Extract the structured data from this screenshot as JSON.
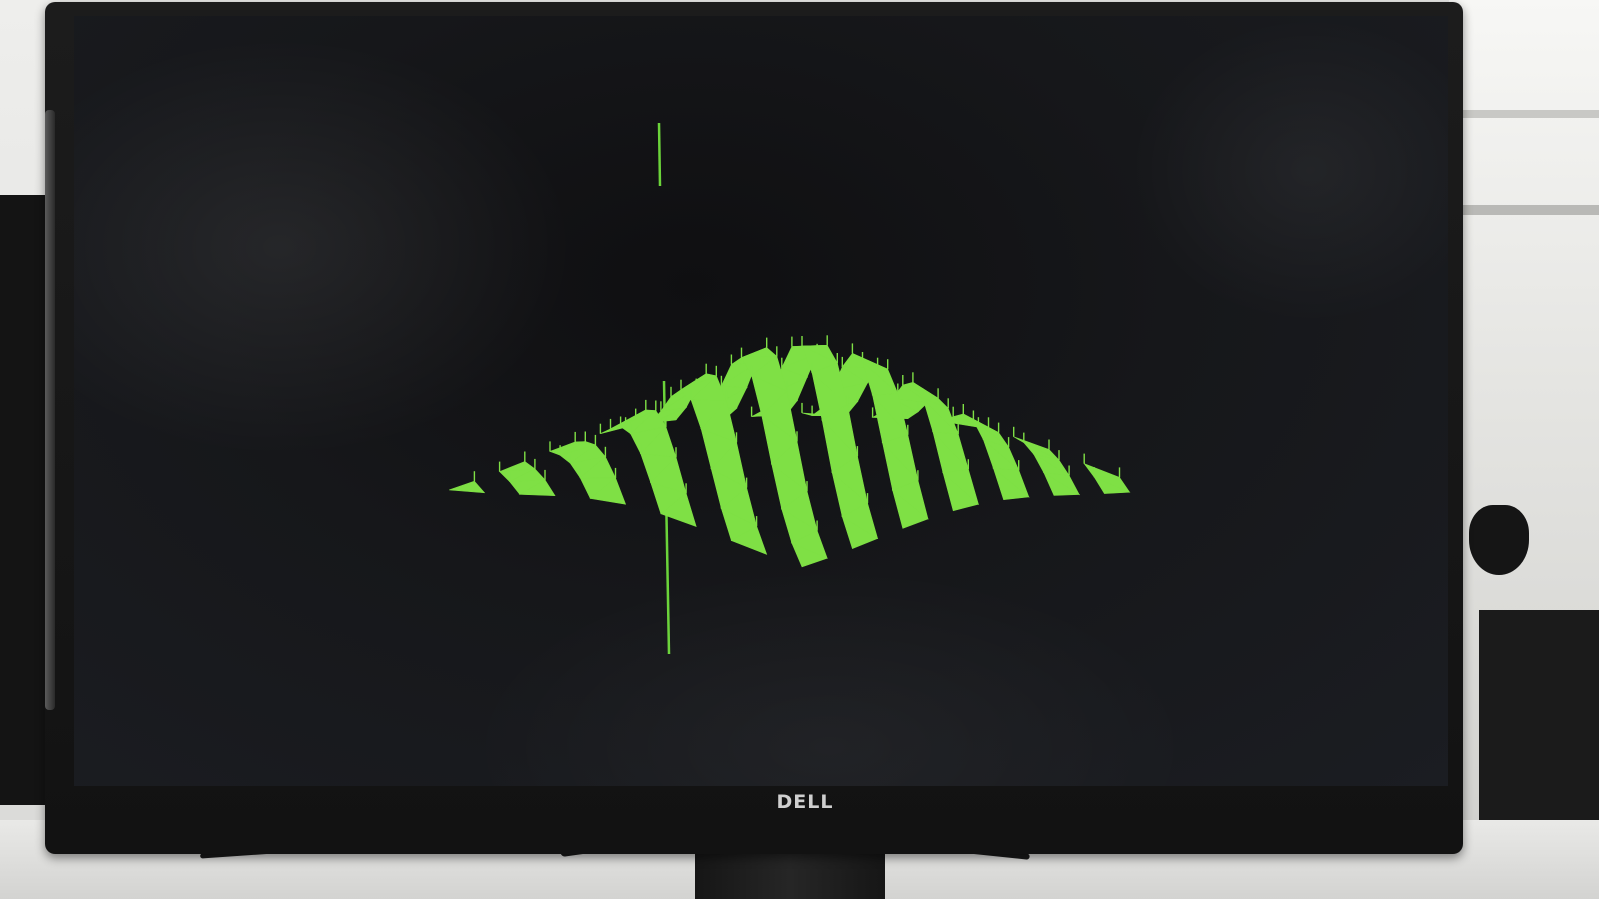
{
  "photo": {
    "description_kind": "photo of a monitor displaying a 3D wireframe surface plot",
    "monitor_brand": "DELL"
  },
  "display": {
    "background_color": "#141518",
    "plot_color": "#7fe045",
    "axis_color": "#6bd43a",
    "surface": {
      "type": "3d-surface",
      "shape": "gaussian-bump",
      "grid_rows": 10,
      "grid_cols": 14,
      "render_style": "filled-triangle-mesh"
    }
  }
}
